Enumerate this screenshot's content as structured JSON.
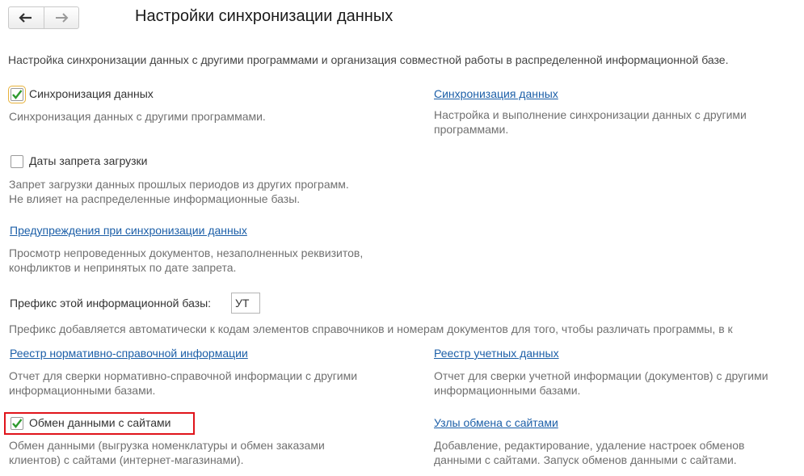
{
  "window": {
    "title": "Настройки синхронизации данных"
  },
  "nav": {
    "back_icon": "arrow-left-icon",
    "forward_icon": "arrow-right-icon"
  },
  "intro": "Настройка синхронизации данных с другими программами и организация совместной работы в распределенной информационной базе.",
  "sync": {
    "checkbox_label": "Синхронизация данных",
    "checked": true,
    "hint": "Синхронизация данных с другими программами.",
    "link": "Синхронизация данных",
    "link_hint_1": "Настройка и выполнение синхронизации данных с другими",
    "link_hint_2": "программами."
  },
  "prohibition": {
    "checkbox_label": "Даты запрета загрузки",
    "checked": false,
    "hint_1": "Запрет загрузки данных прошлых периодов из других программ.",
    "hint_2": "Не влияет на распределенные информационные базы."
  },
  "warnings": {
    "link": "Предупреждения при синхронизации данных",
    "hint_1": "Просмотр непроведенных документов, незаполненных реквизитов,",
    "hint_2": "конфликтов и непринятых по дате запрета."
  },
  "prefix": {
    "label": "Префикс этой информационной базы:",
    "value": "УТ",
    "hint": "Префикс добавляется автоматически к кодам элементов справочников и номерам документов для того, чтобы различать программы, в к"
  },
  "nsi": {
    "link": "Реестр нормативно-справочной информации",
    "hint_1": "Отчет для сверки нормативно-справочной информации с другими",
    "hint_2": "информационными базами."
  },
  "accounting": {
    "link": "Реестр учетных данных",
    "hint_1": "Отчет для сверки учетной информации (документов) с другими",
    "hint_2": "информационными базами."
  },
  "sites": {
    "checkbox_label": "Обмен данными с сайтами",
    "checked": true,
    "hint_1": "Обмен данными (выгрузка номенклатуры и обмен заказами",
    "hint_2": "клиентов) с сайтами (интернет-магазинами).",
    "link": "Узлы обмена с сайтами",
    "link_hint_1": "Добавление, редактирование, удаление настроек обменов",
    "link_hint_2": "данными с сайтами. Запуск обменов данными с сайтами."
  },
  "colors": {
    "link": "#1c5fa8",
    "check": "#2e9a2e",
    "highlight": "#e0141b",
    "focus": "#e8b23a"
  }
}
